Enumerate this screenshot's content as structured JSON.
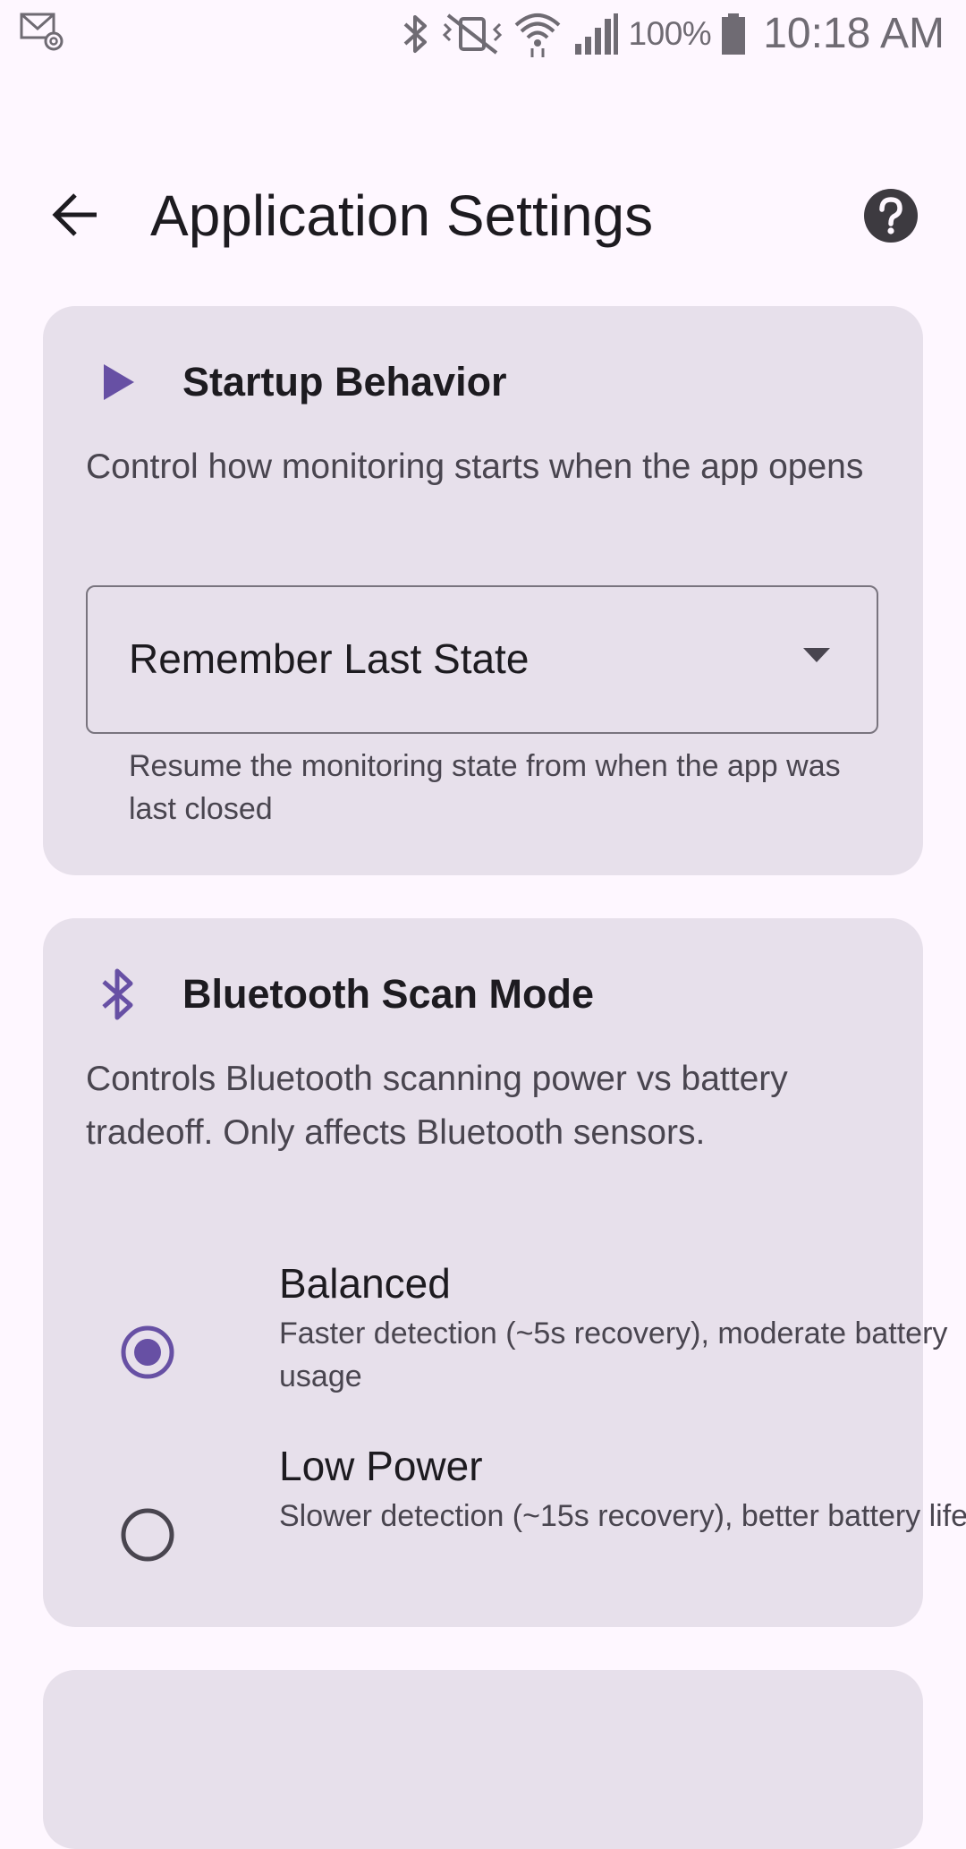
{
  "status_bar": {
    "battery_text": "100%",
    "time": "10:18 AM",
    "icons": [
      "email-notification-icon",
      "bluetooth-icon",
      "vibrate-mute-icon",
      "wifi-icon",
      "cell-signal-icon",
      "battery-icon"
    ]
  },
  "top_bar": {
    "title": "Application Settings",
    "icons": [
      "back-arrow-icon",
      "help-icon"
    ]
  },
  "startup_card": {
    "title": "Startup Behavior",
    "icon": "play-icon",
    "description": "Control how monitoring starts when the app opens",
    "dropdown_value": "Remember Last State",
    "dropdown_helper": "Resume the monitoring state from when the app was last closed"
  },
  "bluetooth_card": {
    "title": "Bluetooth Scan Mode",
    "icon": "bluetooth-icon",
    "description": "Controls Bluetooth scanning power vs battery tradeoff. Only affects Bluetooth sensors.",
    "options": [
      {
        "label": "Balanced",
        "description": "Faster detection (~5s recovery), moderate battery usage",
        "selected": true
      },
      {
        "label": "Low Power",
        "description": "Slower detection (~15s recovery), better battery life",
        "selected": false
      }
    ]
  },
  "colors": {
    "background": "#FEF7FF",
    "card": "#E7E0EB",
    "accent": "#6750A4",
    "text_primary": "#1D1B20",
    "text_secondary": "#49454F",
    "outline": "#79747E"
  }
}
